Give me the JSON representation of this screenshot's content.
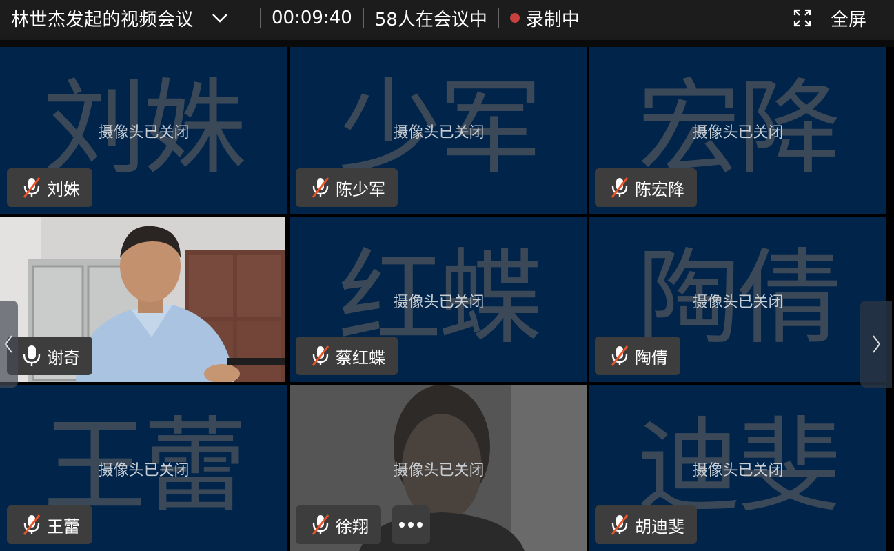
{
  "header": {
    "title": "林世杰发起的视频会议",
    "timer": "00:09:40",
    "participants": "58人在会议中",
    "recording": "录制中",
    "fullscreen": "全屏",
    "record_color": "#c9403f"
  },
  "cam_off_text": "摄像头已关闭",
  "tiles": [
    {
      "big": "刘姝",
      "name": "刘姝",
      "mic": "muted"
    },
    {
      "big": "少军",
      "name": "陈少军",
      "mic": "muted"
    },
    {
      "big": "宏降",
      "name": "陈宏降",
      "mic": "muted"
    },
    {
      "big": "",
      "name": "谢奇",
      "mic": "on"
    },
    {
      "big": "红蝶",
      "name": "蔡红蝶",
      "mic": "muted"
    },
    {
      "big": "陶倩",
      "name": "陶倩",
      "mic": "muted"
    },
    {
      "big": "王蕾",
      "name": "王蕾",
      "mic": "muted"
    },
    {
      "big": "",
      "name": "徐翔",
      "mic": "muted"
    },
    {
      "big": "迪斐",
      "name": "胡迪斐",
      "mic": "muted"
    }
  ],
  "icons": {
    "expand": "chevron-down-icon",
    "fullscreen": "fullscreen-icon",
    "mic_muted": "mic-muted-icon",
    "mic_on": "mic-icon",
    "more": "more-icon",
    "prev": "chevron-left-icon",
    "next": "chevron-right-icon"
  },
  "colors": {
    "tile_bg": "#00244a",
    "muted_slash": "#e8552b"
  }
}
